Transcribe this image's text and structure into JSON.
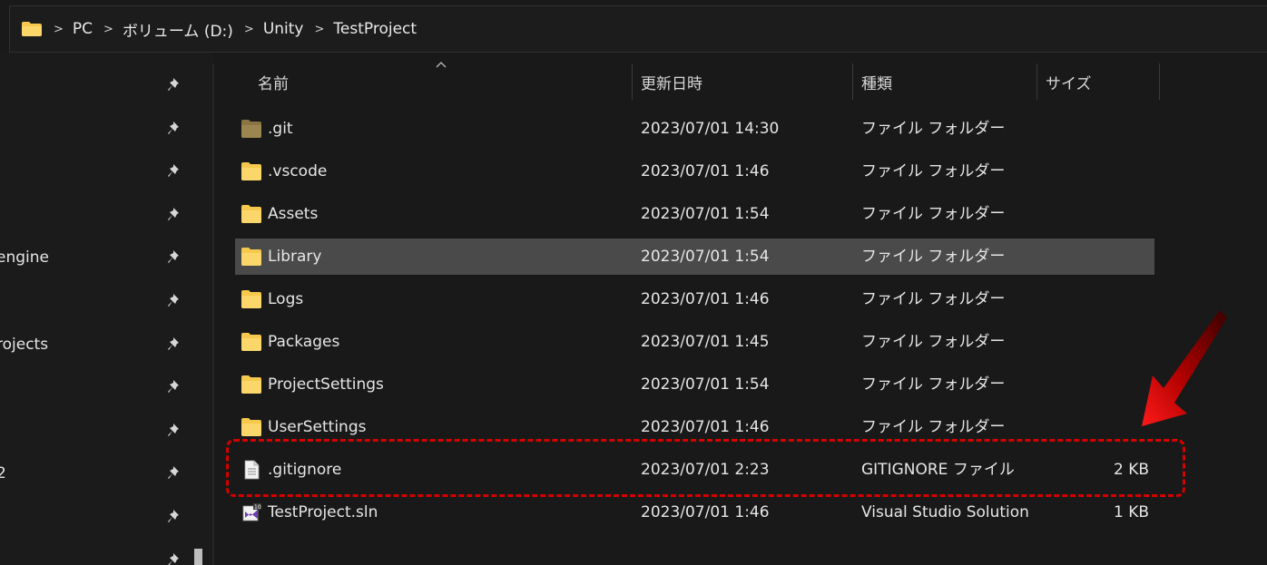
{
  "breadcrumb": {
    "items": [
      "PC",
      "ボリューム (D:)",
      "Unity",
      "TestProject"
    ]
  },
  "nav": {
    "items": [
      {
        "label": ""
      },
      {
        "label": ""
      },
      {
        "label": ""
      },
      {
        "label": ""
      },
      {
        "label": "engine"
      },
      {
        "label": ""
      },
      {
        "label": "rojects"
      },
      {
        "label": ""
      },
      {
        "label": ""
      },
      {
        "label": "2"
      },
      {
        "label": ""
      },
      {
        "label": ""
      }
    ]
  },
  "columns": {
    "name": "名前",
    "modified": "更新日時",
    "type": "種類",
    "size": "サイズ"
  },
  "rows": [
    {
      "name": ".git",
      "modified": "2023/07/01 14:30",
      "type": "ファイル フォルダー",
      "size": "",
      "icon": "folder-hidden-icon"
    },
    {
      "name": ".vscode",
      "modified": "2023/07/01 1:46",
      "type": "ファイル フォルダー",
      "size": "",
      "icon": "folder-icon"
    },
    {
      "name": "Assets",
      "modified": "2023/07/01 1:54",
      "type": "ファイル フォルダー",
      "size": "",
      "icon": "folder-icon"
    },
    {
      "name": "Library",
      "modified": "2023/07/01 1:54",
      "type": "ファイル フォルダー",
      "size": "",
      "icon": "folder-icon"
    },
    {
      "name": "Logs",
      "modified": "2023/07/01 1:46",
      "type": "ファイル フォルダー",
      "size": "",
      "icon": "folder-icon"
    },
    {
      "name": "Packages",
      "modified": "2023/07/01 1:45",
      "type": "ファイル フォルダー",
      "size": "",
      "icon": "folder-icon"
    },
    {
      "name": "ProjectSettings",
      "modified": "2023/07/01 1:54",
      "type": "ファイル フォルダー",
      "size": "",
      "icon": "folder-icon"
    },
    {
      "name": "UserSettings",
      "modified": "2023/07/01 1:46",
      "type": "ファイル フォルダー",
      "size": "",
      "icon": "folder-icon"
    },
    {
      "name": ".gitignore",
      "modified": "2023/07/01 2:23",
      "type": "GITIGNORE ファイル",
      "size": "2 KB",
      "icon": "text-file-icon"
    },
    {
      "name": "TestProject.sln",
      "modified": "2023/07/01 1:46",
      "type": "Visual Studio Solution",
      "size": "1 KB",
      "icon": "visual-studio-solution-icon"
    }
  ],
  "selected_row": "Library",
  "colors": {
    "background": "#191919",
    "selection": "#4a4a4a",
    "folder": "#f6c94e",
    "annotation": "#d30000"
  }
}
